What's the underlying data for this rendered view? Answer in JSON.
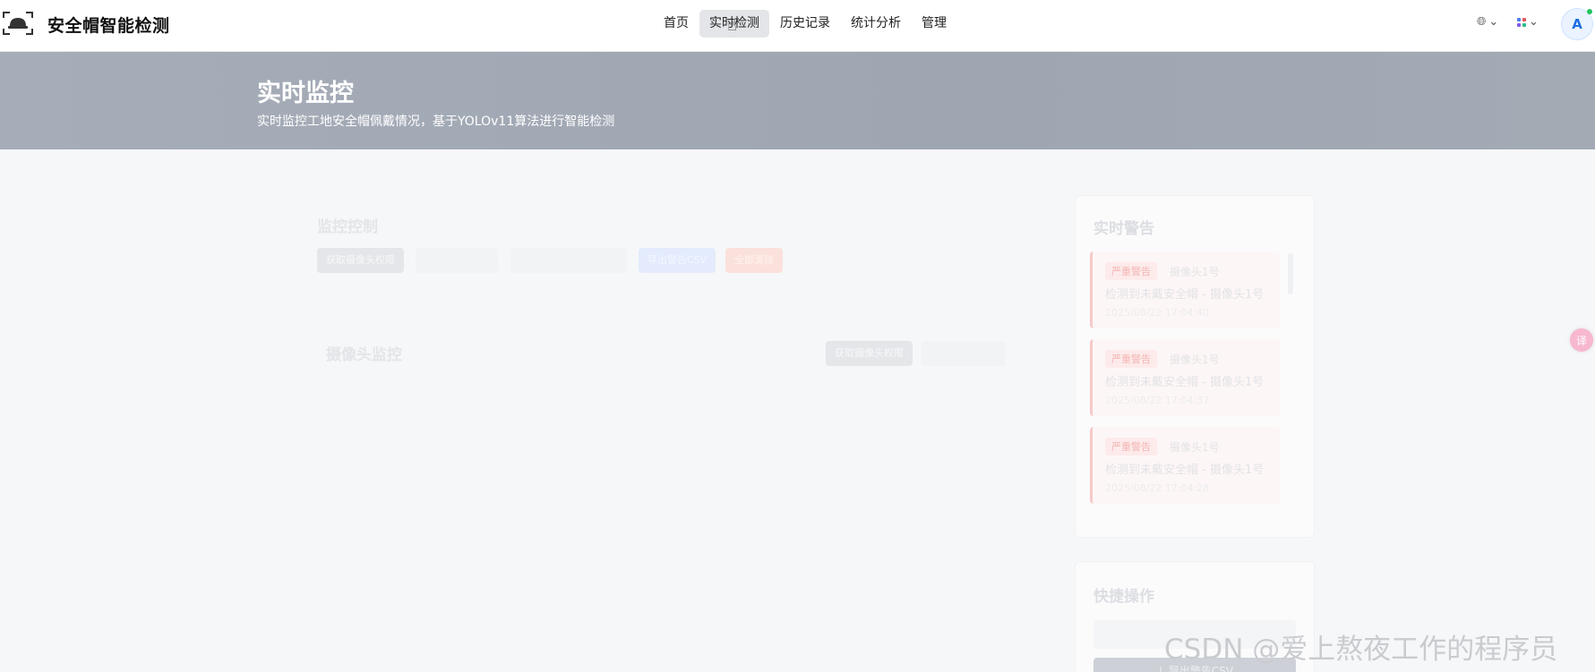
{
  "app": {
    "title": "安全帽智能检测",
    "logo_icon": "helmet-camera-icon"
  },
  "nav": {
    "items": [
      {
        "label": "首页",
        "active": false
      },
      {
        "label": "实时检测",
        "active": true
      },
      {
        "label": "历史记录",
        "active": false
      },
      {
        "label": "统计分析",
        "active": false
      },
      {
        "label": "管理",
        "active": false
      }
    ]
  },
  "toolbar": {
    "language_icon": "globe-icon",
    "apps_icon": "apps-grid-icon",
    "avatar_initial": "A"
  },
  "banner": {
    "title": "实时监控",
    "subtitle": "实时监控工地安全帽佩戴情况，基于YOLOv11算法进行智能检测"
  },
  "monitor": {
    "title": "监控控制",
    "buttons": [
      "获取摄像头权限",
      "",
      "",
      "导出警告CSV",
      "全部清除"
    ],
    "camera_title": "摄像头监控",
    "camera_button": "获取摄像头权限"
  },
  "alerts": {
    "title": "实时警告",
    "items": [
      {
        "tag": "严重警告",
        "camera": "摄像头1号",
        "message": "检测到未戴安全帽 - 摄像头1号",
        "time": "2025/08/22 17:04:40"
      },
      {
        "tag": "严重警告",
        "camera": "摄像头1号",
        "message": "检测到未戴安全帽 - 摄像头1号",
        "time": "2025/08/22 17:04:37"
      },
      {
        "tag": "严重警告",
        "camera": "摄像头1号",
        "message": "检测到未戴安全帽 - 摄像头1号",
        "time": "2025/08/22 17:04:28"
      }
    ]
  },
  "quick": {
    "title": "快捷操作",
    "export_label": "导出警告CSV"
  },
  "watermark": "CSDN @爱上熬夜工作的程序员",
  "colors": {
    "accent": "#1d6fe0",
    "banner": "#a3aab4",
    "alert_border": "#f7c9c9"
  }
}
